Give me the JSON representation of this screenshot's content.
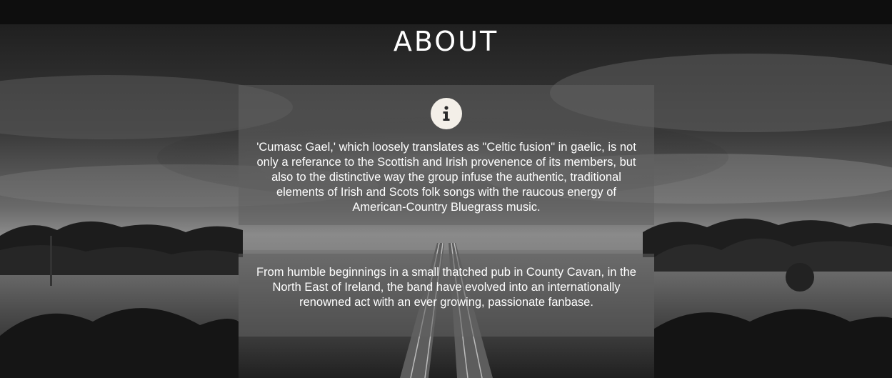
{
  "section": {
    "title": "ABOUT"
  },
  "panels": [
    {
      "icon": "info-icon",
      "text": "'Cumasc Gael,' which loosely translates as \"Celtic fusion\" in gaelic, is not only a referance to the Scottish and Irish provenence of its members, but also to the distinctive way the group infuse the authentic, traditional elements of Irish and Scots folk songs with the raucous energy of American-Country Bluegrass music."
    },
    {
      "text": "From humble beginnings in a small thatched pub in County Cavan, in the North East of Ireland, the band have evolved into an internationally renowned act with an ever growing, passionate fanbase."
    }
  ],
  "colors": {
    "topbar": "#0e0e0e",
    "panel": "#606060",
    "icon_circle": "#f3efe8",
    "icon_glyph": "#2a2a2a",
    "text": "#ffffff"
  }
}
